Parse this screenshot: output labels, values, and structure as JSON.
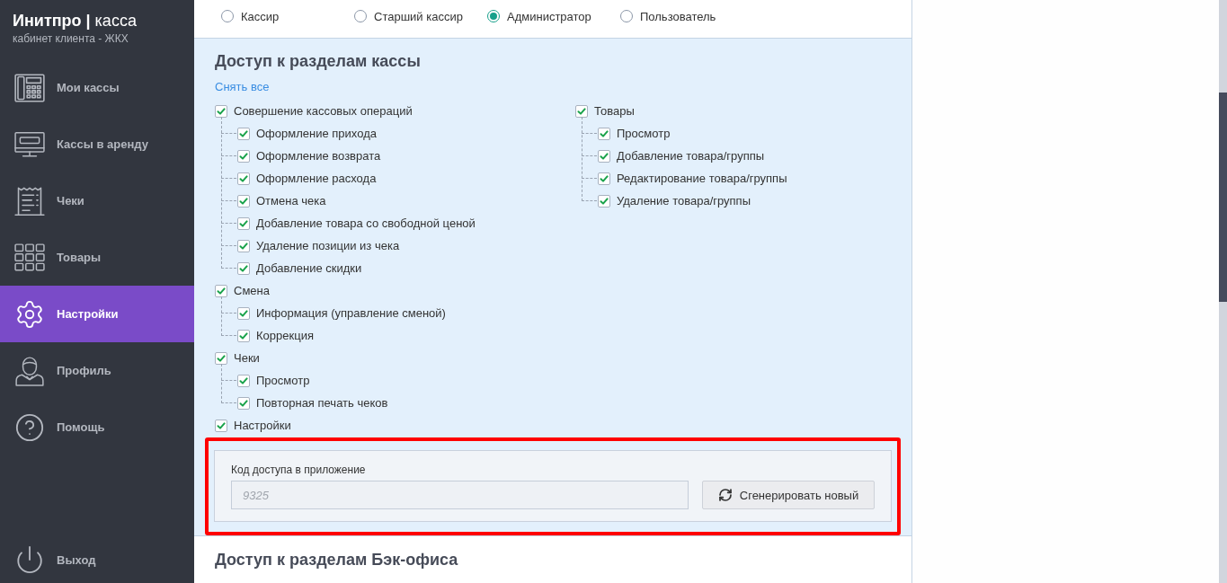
{
  "sidebar": {
    "logo": "**Инитпро |** касса",
    "subtitle": "кабинет клиента - ЖКХ",
    "items": [
      {
        "label": "Мои кассы",
        "selected": false
      },
      {
        "label": "Кассы в аренду",
        "selected": false
      },
      {
        "label": "Чеки",
        "selected": false
      },
      {
        "label": "Товары",
        "selected": false
      },
      {
        "label": "Настройки",
        "selected": true
      },
      {
        "label": "Профиль",
        "selected": false
      },
      {
        "label": "Помощь",
        "selected": false
      }
    ],
    "logout": "Выход"
  },
  "roles": [
    {
      "label": "Кассир",
      "selected": false
    },
    {
      "label": "Старший кассир",
      "selected": false
    },
    {
      "label": "Администратор",
      "selected": true
    },
    {
      "label": "Пользователь",
      "selected": false
    }
  ],
  "cash_access": {
    "title": "Доступ к разделам кассы",
    "clear_link": "Снять все",
    "columns": [
      {
        "groups": [
          {
            "label": "Совершение кассовых операций",
            "checked": true,
            "children": [
              {
                "label": "Оформление прихода",
                "checked": true
              },
              {
                "label": "Оформление возврата",
                "checked": true
              },
              {
                "label": "Оформление расхода",
                "checked": true
              },
              {
                "label": "Отмена чека",
                "checked": true
              },
              {
                "label": "Добавление товара со свободной ценой",
                "checked": true
              },
              {
                "label": "Удаление позиции из чека",
                "checked": true
              },
              {
                "label": "Добавление скидки",
                "checked": true
              }
            ]
          },
          {
            "label": "Смена",
            "checked": true,
            "children": [
              {
                "label": "Информация (управление сменой)",
                "checked": true
              },
              {
                "label": "Коррекция",
                "checked": true
              }
            ]
          },
          {
            "label": "Чеки",
            "checked": true,
            "children": [
              {
                "label": "Просмотр",
                "checked": true
              },
              {
                "label": "Повторная печать чеков",
                "checked": true
              }
            ]
          },
          {
            "label": "Настройки",
            "checked": true
          }
        ]
      },
      {
        "groups": [
          {
            "label": "Товары",
            "checked": true,
            "children": [
              {
                "label": "Просмотр",
                "checked": true
              },
              {
                "label": "Добавление товара/группы",
                "checked": true
              },
              {
                "label": "Редактирование товара/группы",
                "checked": true
              },
              {
                "label": "Удаление товара/группы",
                "checked": true
              }
            ]
          }
        ]
      }
    ]
  },
  "access_code": {
    "highlighted": true,
    "label": "Код доступа в приложение",
    "placeholder": "9325",
    "button": "Сгенерировать новый"
  },
  "backoffice_access": {
    "title": "Доступ к разделам Бэк-офиса"
  }
}
